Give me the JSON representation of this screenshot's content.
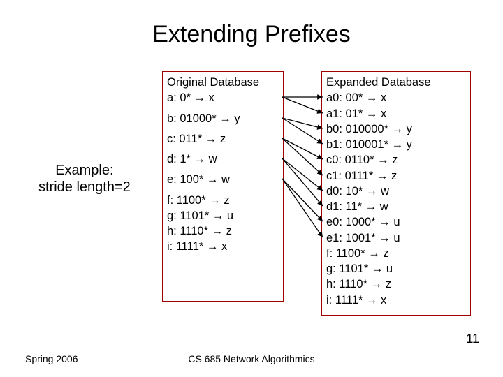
{
  "title": "Extending Prefixes",
  "sidebar": {
    "line1": "Example:",
    "line2": "stride length=2"
  },
  "arrow": "→",
  "original": {
    "header": "Original Database",
    "rows": [
      {
        "label": "a",
        "prefix": "0*",
        "dest": "x"
      },
      {
        "label": "b",
        "prefix": "01000*",
        "dest": "y"
      },
      {
        "label": "c",
        "prefix": "011*",
        "dest": "z"
      },
      {
        "label": "d",
        "prefix": "1*",
        "dest": "w"
      },
      {
        "label": "e",
        "prefix": "100*",
        "dest": "w"
      },
      {
        "label": "f",
        "prefix": "1100*",
        "dest": "z"
      },
      {
        "label": "g",
        "prefix": "1101*",
        "dest": "u"
      },
      {
        "label": "h",
        "prefix": "1110*",
        "dest": "z"
      },
      {
        "label": "i",
        "prefix": "1111*",
        "dest": "x"
      }
    ]
  },
  "expanded": {
    "header": "Expanded Database",
    "rows": [
      {
        "label": "a0",
        "prefix": "00*",
        "dest": "x"
      },
      {
        "label": "a1",
        "prefix": "01*",
        "dest": "x"
      },
      {
        "label": "b0",
        "prefix": "010000*",
        "dest": "y"
      },
      {
        "label": "b1",
        "prefix": "010001*",
        "dest": "y"
      },
      {
        "label": "c0",
        "prefix": "0110*",
        "dest": "z"
      },
      {
        "label": "c1",
        "prefix": "0111*",
        "dest": "z"
      },
      {
        "label": "d0",
        "prefix": "10*",
        "dest": "w"
      },
      {
        "label": "d1",
        "prefix": "11*",
        "dest": "w"
      },
      {
        "label": "e0",
        "prefix": "1000*",
        "dest": "u"
      },
      {
        "label": "e1",
        "prefix": "1001*",
        "dest": "u"
      },
      {
        "label": "f",
        "prefix": "1100*",
        "dest": "z"
      },
      {
        "label": "g",
        "prefix": "1101*",
        "dest": "u"
      },
      {
        "label": "h",
        "prefix": "1110*",
        "dest": "z"
      },
      {
        "label": "i",
        "prefix": "1111*",
        "dest": "x"
      }
    ]
  },
  "arrows": [
    {
      "from": "a",
      "to": "a0"
    },
    {
      "from": "a",
      "to": "a1"
    },
    {
      "from": "b",
      "to": "b0"
    },
    {
      "from": "b",
      "to": "b1"
    },
    {
      "from": "c",
      "to": "c0"
    },
    {
      "from": "c",
      "to": "c1"
    },
    {
      "from": "d",
      "to": "d0"
    },
    {
      "from": "d",
      "to": "d1"
    },
    {
      "from": "e",
      "to": "e0"
    },
    {
      "from": "e",
      "to": "e1"
    }
  ],
  "footer": {
    "left": "Spring 2006",
    "center": "CS 685 Network Algorithmics",
    "right": "11"
  }
}
